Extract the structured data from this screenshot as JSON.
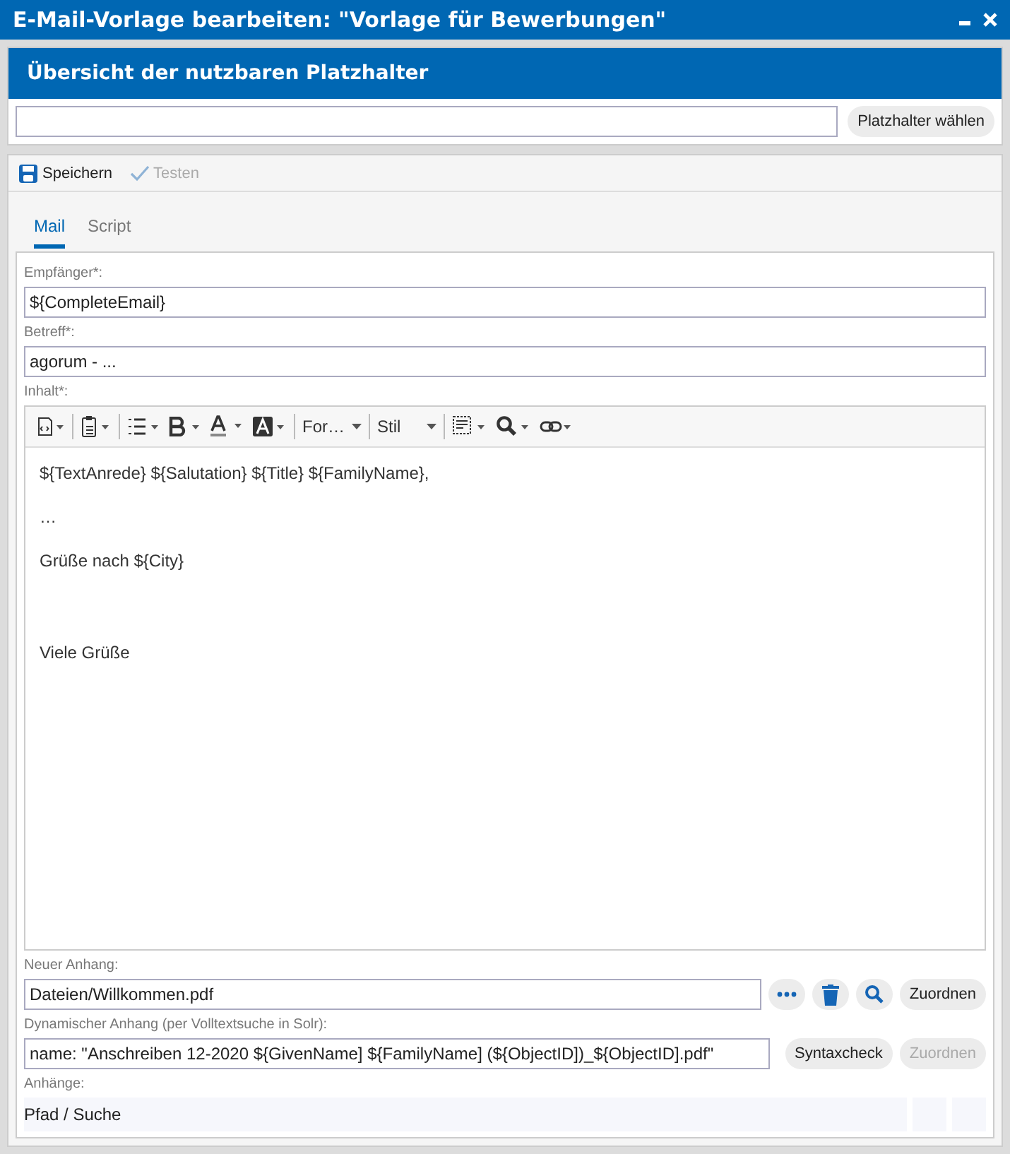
{
  "window": {
    "title": "E-Mail-Vorlage bearbeiten: \"Vorlage für Bewerbungen\""
  },
  "placeholder_panel": {
    "title": "Übersicht der nutzbaren Platzhalter",
    "button": "Platzhalter wählen"
  },
  "toolbar": [
    {
      "kind": "save",
      "label": "Speichern",
      "disabled": false
    },
    {
      "kind": "test",
      "label": "Testen",
      "disabled": true
    }
  ],
  "tabs": [
    {
      "label": "Mail",
      "selected": true
    },
    {
      "label": "Script",
      "selected": false
    }
  ],
  "recipient": {
    "label": "Empfänger*:",
    "value": "${CompleteEmail}"
  },
  "subject": {
    "label": "Betreff*:",
    "value": "agorum - ..."
  },
  "content": {
    "label": "Inhalt*:",
    "format_dropdown": "For…",
    "style_dropdown": "Stil",
    "paragraphs": [
      {
        "text": "${TextAnrede} ${Salutation} ${Title} ${FamilyName},",
        "gap_before": false
      },
      {
        "text": "…",
        "gap_before": false
      },
      {
        "text": "Grüße nach ${City}",
        "gap_before": false
      },
      {
        "text": "Viele Grüße",
        "gap_before": true
      }
    ]
  },
  "new_attachment": {
    "label": "Neuer Anhang:",
    "value": "Dateien/Willkommen.pdf",
    "button": "Zuordnen",
    "disabled": false
  },
  "dynamic_attachment": {
    "label": "Dynamischer Anhang (per Volltextsuche in Solr):",
    "value": "name: \"Anschreiben 12-2020 ${GivenName] ${FamilyName] (${ObjectID])_${ObjectID].pdf\"",
    "check_button": "Syntaxcheck",
    "button": "Zuordnen",
    "disabled": true
  },
  "attachments": {
    "label": "Anhänge:",
    "columns": [
      "Pfad / Suche"
    ]
  }
}
